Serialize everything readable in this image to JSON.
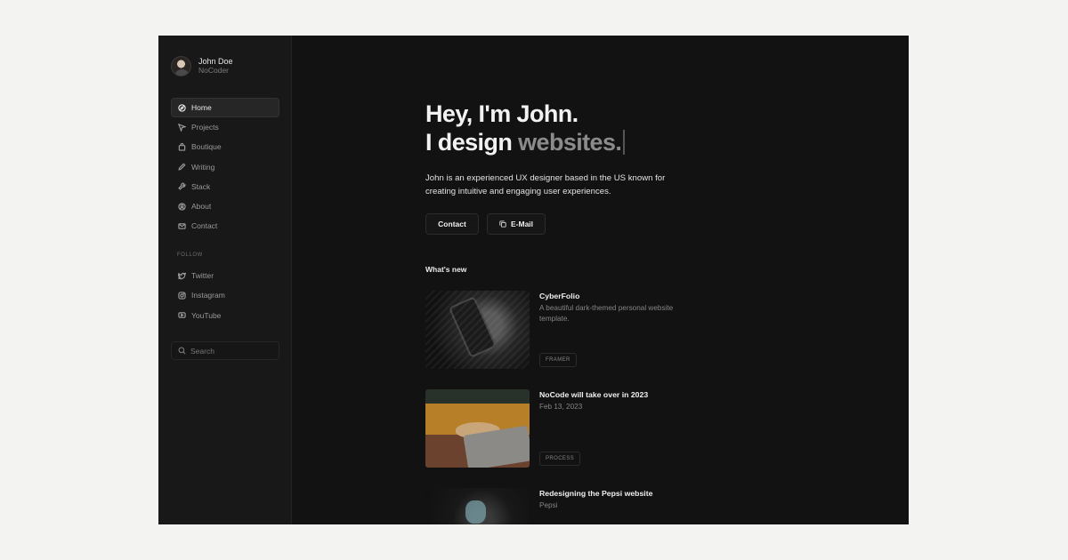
{
  "profile": {
    "name": "John Doe",
    "role": "NoCoder"
  },
  "nav": {
    "items": [
      {
        "label": "Home",
        "icon": "compass-icon"
      },
      {
        "label": "Projects",
        "icon": "send-icon"
      },
      {
        "label": "Boutique",
        "icon": "shopping-bag-icon"
      },
      {
        "label": "Writing",
        "icon": "pen-icon"
      },
      {
        "label": "Stack",
        "icon": "wrench-icon"
      },
      {
        "label": "About",
        "icon": "user-circle-icon"
      },
      {
        "label": "Contact",
        "icon": "mail-icon"
      }
    ]
  },
  "follow": {
    "title": "FOLLOW",
    "items": [
      {
        "label": "Twitter",
        "icon": "twitter-icon"
      },
      {
        "label": "Instagram",
        "icon": "instagram-icon"
      },
      {
        "label": "YouTube",
        "icon": "youtube-icon"
      }
    ]
  },
  "search": {
    "label": "Search"
  },
  "hero": {
    "line1": "Hey, I'm John.",
    "line2_prefix": "I design ",
    "line2_highlight": "websites.",
    "description": "John is an experienced UX designer based in the US known for creating intuitive and engaging user experiences."
  },
  "buttons": {
    "contact": "Contact",
    "email": "E-Mail"
  },
  "whats_new": {
    "title": "What's new",
    "posts": [
      {
        "title": "CyberFolio",
        "subtitle": "A beautiful dark-themed personal website template.",
        "tag": "FRAMER"
      },
      {
        "title": "NoCode will take over in 2023",
        "subtitle": "Feb 13, 2023",
        "tag": "PROCESS"
      },
      {
        "title": "Redesigning the Pepsi website",
        "subtitle": "Pepsi",
        "tag": ""
      }
    ]
  },
  "colors": {
    "background": "#121212",
    "sidebar": "#181818",
    "page": "#f3f3f2",
    "muted_text": "#8b8b8b"
  }
}
